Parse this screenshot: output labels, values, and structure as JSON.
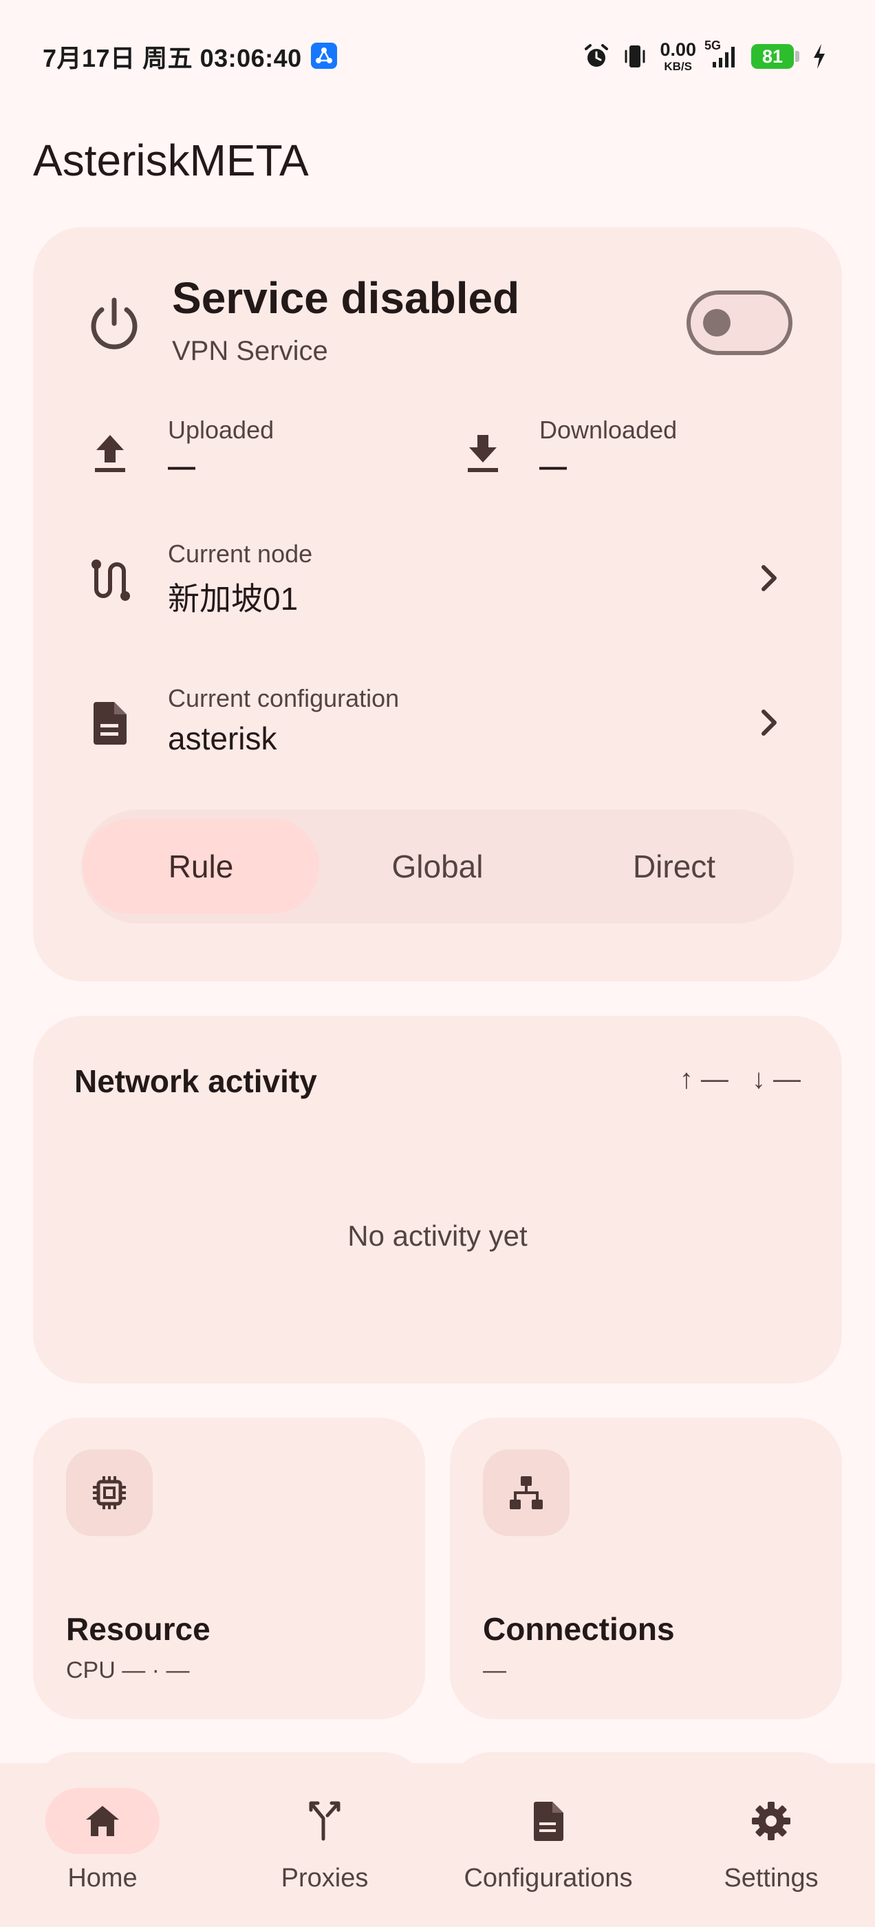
{
  "status_bar": {
    "time": "7月17日 周五 03:06:40",
    "net_speed_value": "0.00",
    "net_speed_unit": "KB/S",
    "signal_label": "5G",
    "battery": "81"
  },
  "app_title": "AsteriskMETA",
  "service": {
    "title": "Service disabled",
    "subtitle": "VPN Service",
    "enabled": false
  },
  "traffic": {
    "uploaded_label": "Uploaded",
    "uploaded_value": "—",
    "downloaded_label": "Downloaded",
    "downloaded_value": "—"
  },
  "current_node": {
    "label": "Current node",
    "value": "新加坡01"
  },
  "current_config": {
    "label": "Current configuration",
    "value": "asterisk"
  },
  "mode": {
    "options": [
      "Rule",
      "Global",
      "Direct"
    ],
    "selected": "Rule"
  },
  "network_activity": {
    "title": "Network activity",
    "up": "↑ —",
    "down": "↓ —",
    "empty": "No activity yet"
  },
  "tiles": {
    "resource": {
      "title": "Resource",
      "subtitle": "CPU — · —"
    },
    "connections": {
      "title": "Connections",
      "subtitle": "—"
    }
  },
  "nav": {
    "items": [
      {
        "label": "Home",
        "icon": "home-icon",
        "active": true
      },
      {
        "label": "Proxies",
        "icon": "fork-icon",
        "active": false
      },
      {
        "label": "Configurations",
        "icon": "file-icon",
        "active": false
      },
      {
        "label": "Settings",
        "icon": "gear-icon",
        "active": false
      }
    ]
  },
  "colors": {
    "background": "#FFF6F5",
    "card": "#FCEAE7",
    "accent_container": "#FFDAD6",
    "text_primary": "#231918",
    "text_secondary": "#534341",
    "outline": "#857371",
    "battery": "#2DBE2D"
  }
}
